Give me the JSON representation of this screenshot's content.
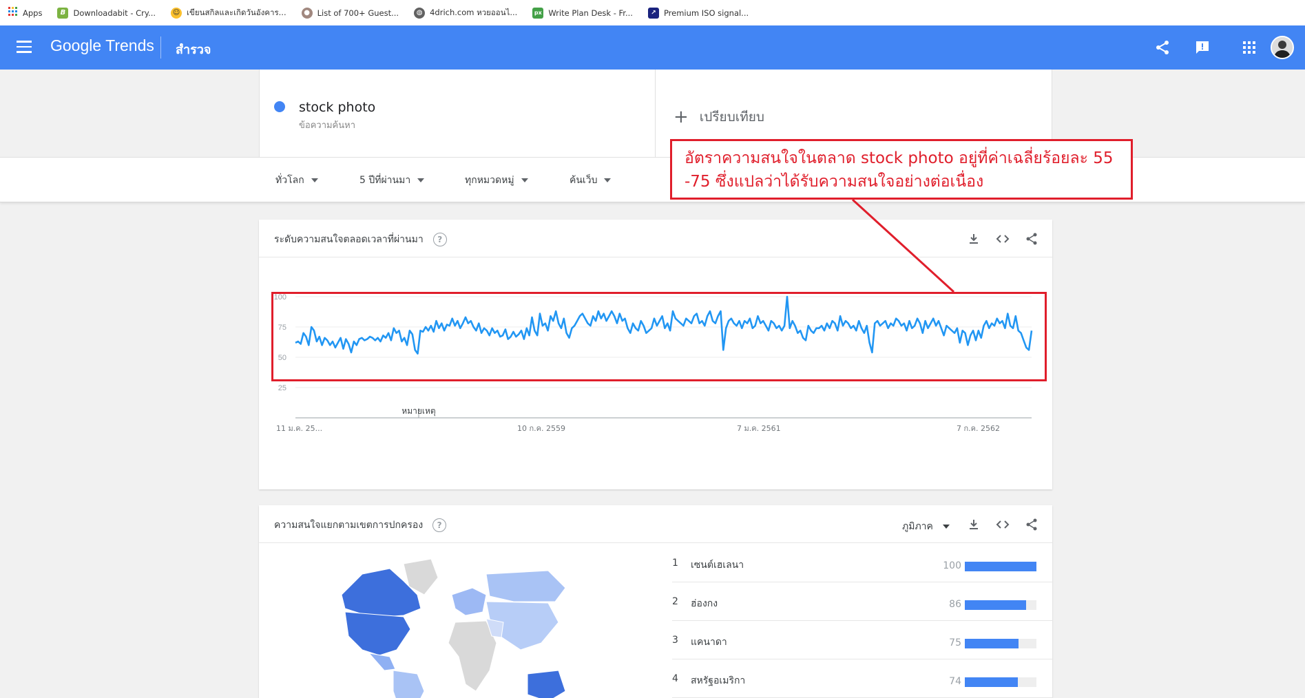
{
  "bookmarks": [
    {
      "label": "Apps",
      "icon": "apps-grid-icon",
      "color": "#4285f4"
    },
    {
      "label": "Downloadabit - Cry...",
      "icon": "b-logo-icon",
      "color": "#7cb342"
    },
    {
      "label": "เขียนสกิลและเกิดวันอังคาร...",
      "icon": "smiley-icon",
      "color": "#fbc02d"
    },
    {
      "label": "List of 700+ Guest...",
      "icon": "monkey-icon",
      "color": "#a1887f"
    },
    {
      "label": "4drich.com หวยออนไ...",
      "icon": "globe-icon",
      "color": "#616161"
    },
    {
      "label": "Write Plan Desk - Fr...",
      "icon": "px-logo-icon",
      "color": "#43a047"
    },
    {
      "label": "Premium ISO signal...",
      "icon": "chart-logo-icon",
      "color": "#1a237e"
    }
  ],
  "header": {
    "logo_google": "Google",
    "logo_trends": "Trends",
    "section": "สำรวจ",
    "bg_color": "#4285f4"
  },
  "search": {
    "term": "stock photo",
    "term_type": "ข้อความค้นหา",
    "compare_label": "เปรียบเทียบ",
    "term_color": "#4285f4"
  },
  "filters": [
    {
      "label": "ทั่วโลก"
    },
    {
      "label": "5 ปีที่ผ่านมา"
    },
    {
      "label": "ทุกหมวดหมู่"
    },
    {
      "label": "ค้นเว็บ"
    }
  ],
  "interest_card": {
    "title": "ระดับความสนใจตลอดเวลาที่ผ่านมา",
    "note_label": "หมายเหตุ"
  },
  "chart_data": {
    "type": "line",
    "title": "",
    "xlabel": "",
    "ylabel": "",
    "ylim": [
      0,
      100
    ],
    "y_ticks": [
      "100",
      "75",
      "50",
      "25"
    ],
    "x_tick_labels": [
      "11 ม.ค. 25...",
      "10 ก.ค. 2559",
      "7 ม.ค. 2561",
      "7 ก.ค. 2562"
    ],
    "series": [
      {
        "name": "stock photo",
        "color": "#2196f3",
        "values": [
          62,
          63,
          61,
          70,
          67,
          60,
          75,
          72,
          63,
          67,
          60,
          66,
          64,
          60,
          63,
          58,
          62,
          66,
          57,
          65,
          61,
          54,
          63,
          60,
          65,
          66,
          64,
          65,
          67,
          66,
          64,
          66,
          63,
          68,
          66,
          70,
          64,
          74,
          70,
          72,
          63,
          66,
          60,
          72,
          69,
          56,
          53,
          72,
          71,
          75,
          72,
          76,
          71,
          80,
          74,
          78,
          72,
          77,
          76,
          82,
          76,
          80,
          74,
          78,
          83,
          78,
          80,
          75,
          72,
          78,
          70,
          74,
          72,
          68,
          74,
          70,
          72,
          67,
          68,
          73,
          65,
          67,
          71,
          67,
          69,
          72,
          65,
          74,
          68,
          83,
          72,
          68,
          86,
          76,
          78,
          72,
          84,
          80,
          88,
          78,
          74,
          82,
          70,
          66,
          74,
          76,
          80,
          84,
          86,
          82,
          78,
          76,
          84,
          80,
          88,
          82,
          86,
          80,
          84,
          88,
          84,
          78,
          86,
          80,
          82,
          74,
          70,
          78,
          74,
          72,
          80,
          76,
          70,
          72,
          74,
          82,
          76,
          80,
          84,
          74,
          78,
          72,
          88,
          82,
          80,
          78,
          76,
          82,
          80,
          78,
          84,
          86,
          78,
          80,
          76,
          84,
          88,
          80,
          78,
          84,
          88,
          56,
          74,
          80,
          82,
          78,
          76,
          80,
          74,
          80,
          78,
          82,
          74,
          76,
          84,
          78,
          80,
          76,
          72,
          80,
          78,
          74,
          76,
          72,
          76,
          100,
          74,
          80,
          76,
          70,
          72,
          66,
          64,
          76,
          72,
          70,
          74,
          74,
          76,
          72,
          78,
          74,
          80,
          78,
          72,
          84,
          76,
          80,
          78,
          74,
          76,
          72,
          80,
          74,
          70,
          76,
          62,
          54,
          78,
          80,
          76,
          78,
          80,
          74,
          78,
          76,
          82,
          80,
          76,
          78,
          72,
          80,
          74,
          76,
          82,
          78,
          70,
          80,
          74,
          78,
          82,
          76,
          80,
          74,
          68,
          76,
          74,
          72,
          70,
          74,
          62,
          72,
          70,
          60,
          68,
          72,
          64,
          72,
          66,
          76,
          80,
          74,
          78,
          76,
          82,
          78,
          80,
          74,
          86,
          76,
          74,
          84,
          72,
          70,
          64,
          58,
          56,
          72
        ]
      }
    ]
  },
  "region_card": {
    "title": "ความสนใจแยกตามเขตการปกครอง",
    "resolution": "ภูมิภาค",
    "rows": [
      {
        "rank": "1",
        "name": "เซนต์เฮเลนา",
        "value": "100",
        "fraction": 1.0
      },
      {
        "rank": "2",
        "name": "ฮ่องกง",
        "value": "86",
        "fraction": 0.86
      },
      {
        "rank": "3",
        "name": "แคนาดา",
        "value": "75",
        "fraction": 0.75
      },
      {
        "rank": "4",
        "name": "สหรัฐอเมริกา",
        "value": "74",
        "fraction": 0.74
      }
    ]
  },
  "annotation": {
    "text": "อัตราความสนใจในตลาด stock photo อยู่ที่ค่าเฉลี่ยร้อยละ 55 -75 ซึ่งแปลว่าได้รับความสนใจอย่างต่อเนื่อง",
    "color": "#e01e2b"
  }
}
